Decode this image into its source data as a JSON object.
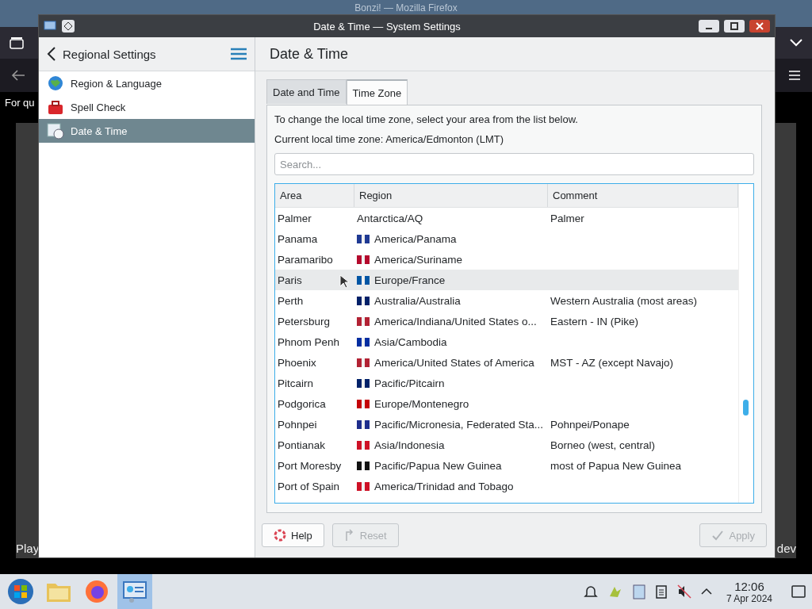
{
  "firefox": {
    "title": "Bonzi! — Mozilla Firefox",
    "page_text": "For qu",
    "caption_left": "Play",
    "caption_right": "dev"
  },
  "dialog": {
    "title": "Date & Time — System Settings"
  },
  "sidebar": {
    "title": "Regional Settings",
    "items": [
      {
        "label": "Region & Language",
        "selected": false,
        "kind": "globe"
      },
      {
        "label": "Spell Check",
        "selected": false,
        "kind": "spell"
      },
      {
        "label": "Date & Time",
        "selected": true,
        "kind": "clock"
      }
    ]
  },
  "page": {
    "title": "Date & Time",
    "tabs": [
      {
        "label": "Date and Time",
        "selected": false
      },
      {
        "label": "Time Zone",
        "selected": true
      }
    ],
    "intro": "To change the local time zone, select your area from the list below.",
    "current": "Current local time zone: America/Edmonton (LMT)",
    "search": {
      "placeholder": "Search..."
    },
    "table": {
      "columns": [
        "Area",
        "Region",
        "Comment"
      ],
      "rows": [
        {
          "area": "Palmer",
          "region": "Antarctica/AQ",
          "comment": "Palmer",
          "highlighted": false
        },
        {
          "area": "Panama",
          "region": "America/Panama",
          "color": "#1f3a93",
          "highlighted": false
        },
        {
          "area": "Paramaribo",
          "region": "America/Suriname",
          "color": "#b40a2d",
          "highlighted": false
        },
        {
          "area": "Paris",
          "region": "Europe/France",
          "color": "#0055a4",
          "highlighted": true
        },
        {
          "area": "Perth",
          "region": "Australia/Australia",
          "comment": "Western Australia (most areas)",
          "color": "#012169",
          "highlighted": false
        },
        {
          "area": "Petersburg",
          "region": "America/Indiana/United States o...",
          "comment": "Eastern - IN (Pike)",
          "color": "#b22234",
          "highlighted": false
        },
        {
          "area": "Phnom Penh",
          "region": "Asia/Cambodia",
          "color": "#032ea1",
          "highlighted": false
        },
        {
          "area": "Phoenix",
          "region": "America/United States of America",
          "comment": "MST - AZ (except Navajo)",
          "color": "#b22234",
          "highlighted": false
        },
        {
          "area": "Pitcairn",
          "region": "Pacific/Pitcairn",
          "color": "#012169",
          "highlighted": false
        },
        {
          "area": "Podgorica",
          "region": "Europe/Montenegro",
          "color": "#c40308",
          "highlighted": false
        },
        {
          "area": "Pohnpei",
          "region": "Pacific/Micronesia, Federated Sta...",
          "comment": "Pohnpei/Ponape",
          "color": "#1e2d8c",
          "highlighted": false
        },
        {
          "area": "Pontianak",
          "region": "Asia/Indonesia",
          "comment": "Borneo (west, central)",
          "color": "#ce1126",
          "highlighted": false
        },
        {
          "area": "Port Moresby",
          "region": "Pacific/Papua New Guinea",
          "comment": "most of Papua New Guinea",
          "color": "#111111",
          "highlighted": false
        },
        {
          "area": "Port of Spain",
          "region": "America/Trinidad and Tobago",
          "color": "#ce1126",
          "highlighted": false
        }
      ]
    }
  },
  "buttons": [
    {
      "label": "Help",
      "disabled": false,
      "kind": "help"
    },
    {
      "label": "Reset",
      "disabled": true,
      "kind": "reset"
    },
    {
      "label": "Apply",
      "disabled": true,
      "kind": "apply"
    }
  ],
  "taskbar": {
    "apps": [
      {
        "kind": "start",
        "selected": false
      },
      {
        "kind": "files",
        "selected": false
      },
      {
        "kind": "browser",
        "selected": false
      },
      {
        "kind": "settings",
        "selected": true
      }
    ],
    "time": "12:06",
    "date": "7 Apr 2024"
  }
}
